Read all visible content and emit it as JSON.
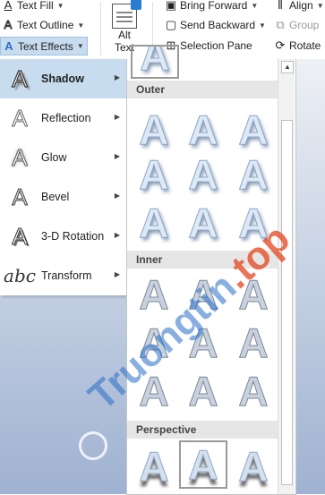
{
  "ribbon": {
    "text_fill_label": "Text Fill",
    "text_outline_label": "Text Outline",
    "text_effects_label": "Text Effects",
    "alt_text_label_line1": "Alt",
    "alt_text_label_line2": "Text",
    "bring_forward_label": "Bring Forward",
    "send_backward_label": "Send Backward",
    "selection_pane_label": "Selection Pane",
    "align_label": "Align",
    "group_label": "Group",
    "rotate_label": "Rotate"
  },
  "effects_menu": {
    "items": [
      {
        "label": "Shadow",
        "icon": "shadow-a-icon",
        "active": true
      },
      {
        "label": "Reflection",
        "icon": "reflection-a-icon"
      },
      {
        "label": "Glow",
        "icon": "glow-a-icon"
      },
      {
        "label": "Bevel",
        "icon": "bevel-a-icon"
      },
      {
        "label": "3-D Rotation",
        "icon": "3d-rotation-a-icon"
      },
      {
        "label": "Transform",
        "icon": "transform-abc-icon",
        "glyph": "abc"
      }
    ],
    "glyph": "A"
  },
  "gallery": {
    "sections": {
      "outer": "Outer",
      "inner": "Inner",
      "perspective": "Perspective"
    },
    "sample_glyph": "A"
  },
  "watermark": {
    "text_blue": "Truongtin",
    "text_orange": ".top"
  },
  "colors": {
    "menu_highlight": "#c8dcef",
    "section_header": "#e6e6e6",
    "gallery_outer_glyph": "#dfe9f6",
    "watermark_blue": "#2e6ec8",
    "watermark_orange": "#e6461e"
  }
}
